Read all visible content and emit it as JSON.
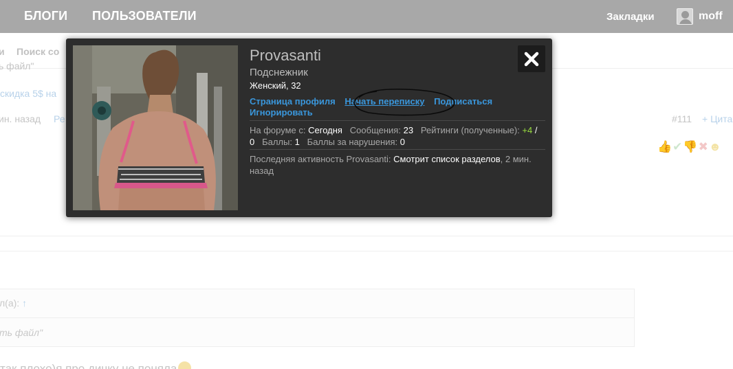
{
  "topnav": {
    "blogs": "БЛОГИ",
    "users": "ПОЛЬЗОВАТЕЛИ",
    "bookmarks": "Закладки",
    "username": "moff"
  },
  "background": {
    "subnav_left": "и",
    "subnav_search": "Поиск со",
    "line_file": "ь файл\"",
    "line_discount": "скидка 5$ на",
    "line_time": "ин. назад",
    "line_edit": "Ре",
    "post_number": "#111",
    "quote_link": "+ Цита",
    "quote_author": "л(а): ",
    "quote_arrow": "↑",
    "quote_text": "ть файл\"",
    "post_text": "так плохо)я про дичку не поняла"
  },
  "popup": {
    "name": "Provasanti",
    "user_title": "Подснежник",
    "gender_age": "Женский, 32",
    "links": {
      "profile": "Страница профиля",
      "message": "Начать переписку",
      "follow": "Подписаться",
      "ignore": "Игнорировать"
    },
    "stats": {
      "forum_since_label": "На форуме с:",
      "forum_since_value": "Сегодня",
      "messages_label": "Сообщения:",
      "messages_value": "23",
      "ratings_label": "Рейтинги (полученные):",
      "ratings_positive": "+4",
      "ratings_sep": " / ",
      "ratings_negative": "0",
      "points_label": "Баллы:",
      "points_value": "1",
      "violations_label": "Баллы за нарушения:",
      "violations_value": "0"
    },
    "activity": {
      "label": "Последняя активность Provasanti:",
      "value": "Смотрит список разделов",
      "time": ", 2 мин. назад"
    }
  }
}
